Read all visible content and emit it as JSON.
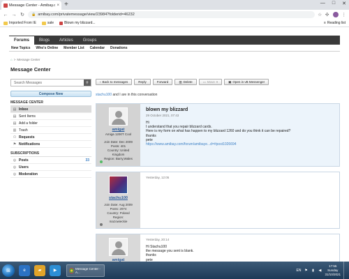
{
  "browser": {
    "tab_title": "Message Center - Amibay.com | ",
    "tab_close": "×",
    "new_tab": "+",
    "window_controls": [
      "—",
      "□",
      "✕"
    ],
    "url": "amibay.com/privatemessage/view/23984?folderid=46232",
    "bookmarks": [
      {
        "label": "Imported From IE",
        "icon": "folder-icon"
      },
      {
        "label": "sale",
        "icon": "folder-icon"
      },
      {
        "label": "Blown my blizzard...",
        "icon": "favicon-icon"
      }
    ],
    "reading_list": "Reading list"
  },
  "site_nav": {
    "main": [
      {
        "label": "Forums",
        "active": true
      },
      {
        "label": "Blogs",
        "active": false
      },
      {
        "label": "Articles",
        "active": false
      },
      {
        "label": "Groups",
        "active": false
      }
    ],
    "sub": [
      "New Topics",
      "Who's Online",
      "Member List",
      "Calendar",
      "Donations"
    ]
  },
  "breadcrumb": {
    "sep": ">",
    "current": "Message Center"
  },
  "page_title": "Message Center",
  "sidebar": {
    "search_placeholder": "Search Messages",
    "compose_label": "Compose New",
    "message_center_heading": "MESSAGE CENTER",
    "items": [
      {
        "label": "Inbox",
        "icon": "inbox-icon",
        "selected": true
      },
      {
        "label": "Sent Items",
        "icon": "sent-icon",
        "selected": false
      },
      {
        "label": "Add a folder",
        "icon": "add-folder-icon",
        "selected": false
      },
      {
        "label": "Trash",
        "icon": "trash-icon",
        "selected": false
      },
      {
        "label": "Requests",
        "icon": "requests-icon",
        "selected": false,
        "bold": true
      },
      {
        "label": "Notifications",
        "icon": "notifications-icon",
        "selected": false,
        "bold": true
      }
    ],
    "subscriptions_heading": "SUBSCRIPTIONS",
    "subscriptions": [
      {
        "label": "Posts",
        "icon": "posts-icon",
        "count": "33"
      },
      {
        "label": "Users",
        "icon": "users-icon",
        "count": ""
      },
      {
        "label": "Moderation",
        "icon": "moderation-icon",
        "count": ""
      }
    ]
  },
  "toolbar": {
    "back": "Back to messages",
    "reply": "Reply",
    "forward": "Forward",
    "delete": "Delete",
    "move": "Move",
    "open_messenger": "Open in vB Messenger"
  },
  "participants": {
    "user": "stachu100",
    "text": " and I are in this conversation"
  },
  "posts": [
    {
      "username": "amigat",
      "user_title": "Amiga 1200T Cool",
      "stats": [
        "Join Date: Dec 2009",
        "Posts: 401",
        "Country: United",
        "Kingdom",
        "Region: Barry,Wales"
      ],
      "online": true,
      "title": "blown my blizzard",
      "date": "29 October 2021, 07:43",
      "lines": [
        "Hi",
        "I understand that you repair blizzard cards.",
        "Here is my form on what has happen to my blizzard 1260 and do you think it can be repaired?",
        "thanks",
        "pete",
        "https://www.amibay.com/forum/amibaye...d=#post1026694"
      ]
    },
    {
      "username": "stachu100",
      "user_title": "",
      "stats": [
        "Join Date: Aug 2009",
        "Posts: 2074",
        "Country: Poland",
        "Region:",
        "mazowieckie"
      ],
      "online": false,
      "title": "",
      "date": "Yesterday, 12:05",
      "lines": []
    },
    {
      "username": "amigat",
      "user_title": "",
      "stats": [],
      "online": true,
      "title": "",
      "date": "Yesterday, 20:14",
      "lines": [
        "Hi Stachu100",
        "the message you sent is blank.",
        "thanks",
        "pete"
      ]
    }
  ],
  "taskbar": {
    "app_label": "Message Center - A...",
    "language": "EN",
    "time": "17:55",
    "day": "Sunday",
    "date": "31/10/2021"
  },
  "colors": {
    "accent": "#3b7fc4",
    "nav_bg": "#3a3a3a",
    "unread_bg": "#ecf4fb"
  }
}
